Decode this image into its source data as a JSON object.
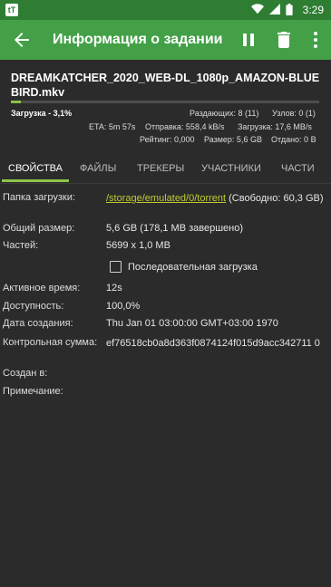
{
  "statusbar": {
    "time": "3:29",
    "app_badge": "tT"
  },
  "appbar": {
    "title": "Информация о задании",
    "icons": [
      "back-arrow-icon",
      "pause-icon",
      "trash-icon",
      "more-vert-icon"
    ]
  },
  "torrent": {
    "filename": "DREAMKATCHER_2020_WEB-DL_1080p_AMAZON-BLUEBIRD.mkv",
    "progress_fraction": 0.031,
    "status": "Загрузка - 3,1%",
    "seeders": "Раздающих: 8 (11)",
    "peers": "Узлов: 0 (1)",
    "eta": "ETA: 5m 57s",
    "upload": "Отправка: 558,4 kB/s",
    "download": "Загрузка: 17,6 MB/s",
    "rating": "Рейтинг: 0,000",
    "size": "Размер: 5,6 GB",
    "given": "Отдано: 0 B"
  },
  "tabs": [
    "СВОЙСТВА",
    "ФАЙЛЫ",
    "ТРЕКЕРЫ",
    "УЧАСТНИКИ",
    "ЧАСТИ"
  ],
  "details": {
    "download_folder_label": "Папка загрузки:",
    "download_folder_path": "/storage/emulated/0/torrent",
    "download_folder_free": " (Свободно: 60,3 GB)",
    "total_size_label": "Общий размер:",
    "total_size_value": "5,6 GB (178,1 MB завершено)",
    "parts_label": "Частей:",
    "parts_value": "5699 x 1,0 MB",
    "sequential_label": "Последовательная загрузка",
    "active_time_label": "Активное время:",
    "active_time_value": "12s",
    "availability_label": "Доступность:",
    "availability_value": "100,0%",
    "creation_date_label": "Дата создания:",
    "creation_date_value": "Thu Jan 01 03:00:00 GMT+03:00 1970",
    "checksum_label": "Контрольная сумма:",
    "checksum_value": "ef76518cb0a8d363f0874124f015d9acc342711 0",
    "created_in_label": "Создан в:",
    "note_label": "Примечание:"
  },
  "colors": {
    "statusbar": "#2e7d32",
    "appbar": "#43a047",
    "accent": "#8bc34a",
    "link": "#c0ca33",
    "background": "#2b2b2b"
  }
}
